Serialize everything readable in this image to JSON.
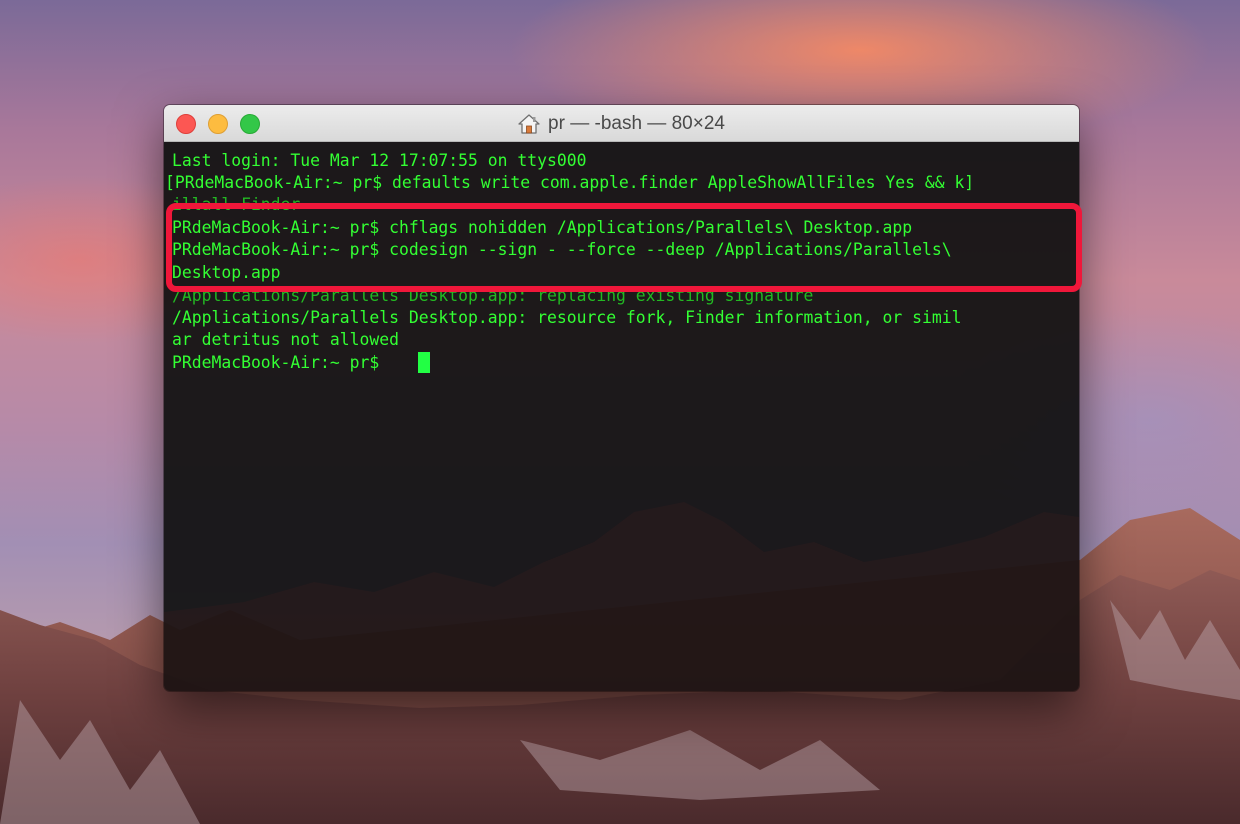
{
  "window": {
    "title": "pr — -bash — 80×24",
    "title_icon": "home-folder-icon"
  },
  "terminal": {
    "lines": [
      "Last login: Tue Mar 12 17:07:55 on ttys000",
      "[PRdeMacBook-Air:~ pr$ defaults write com.apple.finder AppleShowAllFiles Yes && k]",
      "illall Finder",
      "PRdeMacBook-Air:~ pr$ chflags nohidden /Applications/Parallels\\ Desktop.app",
      "PRdeMacBook-Air:~ pr$ codesign --sign - --force --deep /Applications/Parallels\\",
      "Desktop.app",
      "/Applications/Parallels Desktop.app: replacing existing signature",
      "/Applications/Parallels Desktop.app: resource fork, Finder information, or simil",
      "ar detritus not allowed",
      "PRdeMacBook-Air:~ pr$ "
    ]
  },
  "colors": {
    "terminal_text": "#33ff33",
    "highlight": "#f0173a",
    "close_button": "#fc5753",
    "minimize_button": "#fdbc40",
    "zoom_button": "#33c748"
  }
}
